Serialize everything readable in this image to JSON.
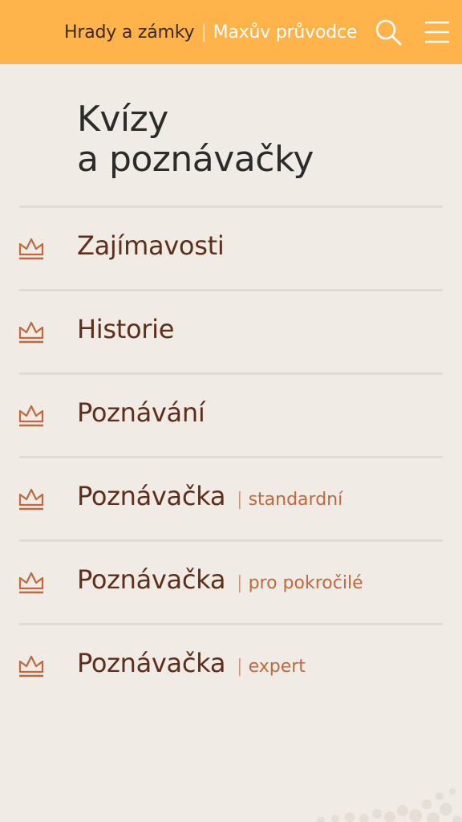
{
  "header": {
    "brand_main": "Hrady a zámky",
    "brand_separator": "|",
    "brand_sub": "Maxův průvodce",
    "search_icon": "search-icon",
    "menu_icon": "hamburger-menu-icon",
    "background_color": "#ffb34a"
  },
  "page": {
    "title_line1": "Kvízy",
    "title_line2": "a poznávačky"
  },
  "quiz_list": {
    "item_icon": "crown-icon",
    "items": [
      {
        "title": "Zajímavosti",
        "separator": "",
        "subtitle": ""
      },
      {
        "title": "Historie",
        "separator": "",
        "subtitle": ""
      },
      {
        "title": "Poznávání",
        "separator": "",
        "subtitle": ""
      },
      {
        "title": "Poznávačka",
        "separator": "|",
        "subtitle": "standardní"
      },
      {
        "title": "Poznávačka",
        "separator": "|",
        "subtitle": "pro pokročilé"
      },
      {
        "title": "Poznávačka",
        "separator": "|",
        "subtitle": "expert"
      }
    ]
  },
  "colors": {
    "background": "#f0ebe5",
    "item_title": "#5e2e1a",
    "item_subtitle": "#c0683e",
    "crown": "#c0683e",
    "divider": "#e2dbd3"
  }
}
